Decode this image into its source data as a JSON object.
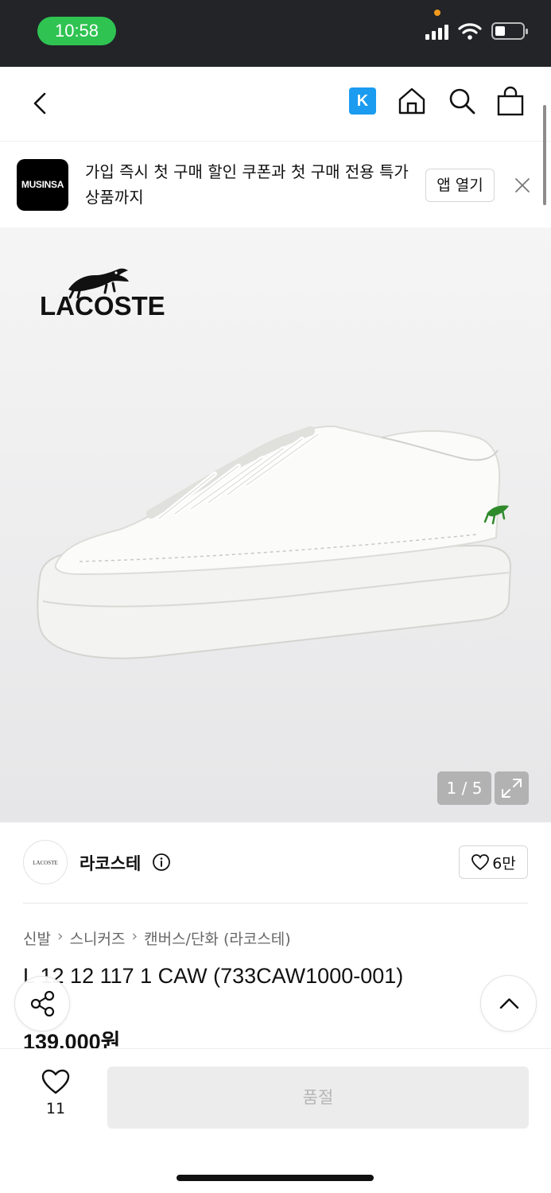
{
  "status_bar": {
    "time": "10:58",
    "icons": [
      "signal-icon",
      "wifi-icon",
      "battery-icon"
    ],
    "accent": "#2fc352"
  },
  "nav": {
    "back_icon": "chevron-left-icon",
    "k_label": "K",
    "icons": [
      "home-icon",
      "search-icon",
      "shopping-bag-icon"
    ]
  },
  "banner": {
    "logo_text": "MUSINSA",
    "message": "가입 즉시 첫 구매 할인 쿠폰과 첫 구매 전용 특가 상품까지",
    "open_app_label": "앱 열기",
    "close_icon": "close-icon"
  },
  "gallery": {
    "brand_wordmark": "LACOSTE",
    "current": 1,
    "total": 5,
    "counter": "1 / 5",
    "expand_icon": "expand-icon"
  },
  "brand": {
    "avatar_text": "LACOSTE",
    "name": "라코스테",
    "like_count": "6만"
  },
  "breadcrumb": [
    "신발",
    "스니커즈",
    "캔버스/단화 (라코스테)"
  ],
  "product": {
    "title": "L 12 12 117 1 CAW (733CAW1000-001)",
    "price": "139,000원"
  },
  "bottom_bar": {
    "wish_count": "11",
    "soldout_label": "품절"
  },
  "colors": {
    "status_bg": "#222428",
    "k_blue": "#1b9cf0",
    "soldout_bg": "#ececec",
    "soldout_text": "#b5b5b5"
  }
}
